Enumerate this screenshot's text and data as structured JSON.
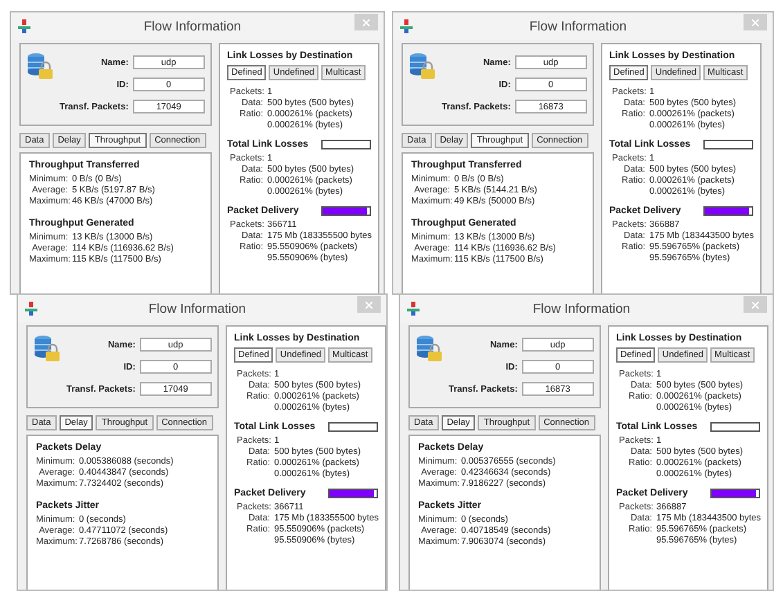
{
  "windows": [
    {
      "title": "Flow Information",
      "info": [
        {
          "label": "Name:",
          "value": "udp"
        },
        {
          "label": "ID:",
          "value": "0"
        },
        {
          "label": "Transf. Packets:",
          "value": "17049"
        }
      ],
      "tabs": [
        {
          "label": "Data",
          "selected": false
        },
        {
          "label": "Delay",
          "selected": false
        },
        {
          "label": "Throughput",
          "selected": true
        },
        {
          "label": "Connection",
          "selected": false
        }
      ],
      "sections": [
        {
          "title": "Throughput Transferred",
          "rows": [
            {
              "label": "Minimum:",
              "value": "0 B/s (0 B/s)"
            },
            {
              "label": "Average:",
              "value": "5 KB/s (5197.87 B/s)"
            },
            {
              "label": "Maximum:",
              "value": "46 KB/s (47000 B/s)"
            }
          ]
        },
        {
          "title": "Throughput Generated",
          "rows": [
            {
              "label": "Minimum:",
              "value": "13 KB/s (13000 B/s)"
            },
            {
              "label": "Average:",
              "value": "114 KB/s (116936.62 B/s)"
            },
            {
              "label": "Maximum:",
              "value": "115 KB/s (117500 B/s)"
            }
          ]
        }
      ],
      "link_losses": {
        "title": "Link Losses by Destination",
        "buttons": [
          {
            "label": "Defined",
            "selected": true
          },
          {
            "label": "Undefined",
            "selected": false
          },
          {
            "label": "Multicast",
            "selected": false
          }
        ],
        "rows": [
          {
            "label": "Packets:",
            "value": "1"
          },
          {
            "label": "Data:",
            "value": "500 bytes (500 bytes)"
          },
          {
            "label": "Ratio:",
            "value": "0.000261% (packets)"
          },
          {
            "value": "0.000261% (bytes)"
          }
        ]
      },
      "total_link_losses": {
        "title": "Total Link Losses",
        "rows": [
          {
            "label": "Packets:",
            "value": "1"
          },
          {
            "label": "Data:",
            "value": "500 bytes (500 bytes)"
          },
          {
            "label": "Ratio:",
            "value": "0.000261% (packets)"
          },
          {
            "value": "0.000261% (bytes)"
          }
        ]
      },
      "packet_delivery": {
        "title": "Packet Delivery",
        "level": 0.96,
        "rows": [
          {
            "label": "Packets:",
            "value": "366711"
          },
          {
            "label": "Data:",
            "value": "175 Mb (183355500 bytes"
          },
          {
            "label": "Ratio:",
            "value": "95.550906% (packets)"
          },
          {
            "value": "95.550906% (bytes)"
          }
        ]
      }
    },
    {
      "title": "Flow Information",
      "info": [
        {
          "label": "Name:",
          "value": "udp"
        },
        {
          "label": "ID:",
          "value": "0"
        },
        {
          "label": "Transf. Packets:",
          "value": "16873"
        }
      ],
      "tabs": [
        {
          "label": "Data",
          "selected": false
        },
        {
          "label": "Delay",
          "selected": false
        },
        {
          "label": "Throughput",
          "selected": true
        },
        {
          "label": "Connection",
          "selected": false
        }
      ],
      "sections": [
        {
          "title": "Throughput Transferred",
          "rows": [
            {
              "label": "Minimum:",
              "value": "0 B/s (0 B/s)"
            },
            {
              "label": "Average:",
              "value": "5 KB/s (5144.21 B/s)"
            },
            {
              "label": "Maximum:",
              "value": "49 KB/s (50000 B/s)"
            }
          ]
        },
        {
          "title": "Throughput Generated",
          "rows": [
            {
              "label": "Minimum:",
              "value": "13 KB/s (13000 B/s)"
            },
            {
              "label": "Average:",
              "value": "114 KB/s (116936.62 B/s)"
            },
            {
              "label": "Maximum:",
              "value": "115 KB/s (117500 B/s)"
            }
          ]
        }
      ],
      "link_losses": {
        "title": "Link Losses by Destination",
        "buttons": [
          {
            "label": "Defined",
            "selected": true
          },
          {
            "label": "Undefined",
            "selected": false
          },
          {
            "label": "Multicast",
            "selected": false
          }
        ],
        "rows": [
          {
            "label": "Packets:",
            "value": "1"
          },
          {
            "label": "Data:",
            "value": "500 bytes (500 bytes)"
          },
          {
            "label": "Ratio:",
            "value": "0.000261% (packets)"
          },
          {
            "value": "0.000261% (bytes)"
          }
        ]
      },
      "total_link_losses": {
        "title": "Total Link Losses",
        "rows": [
          {
            "label": "Packets:",
            "value": "1"
          },
          {
            "label": "Data:",
            "value": "500 bytes (500 bytes)"
          },
          {
            "label": "Ratio:",
            "value": "0.000261% (packets)"
          },
          {
            "value": "0.000261% (bytes)"
          }
        ]
      },
      "packet_delivery": {
        "title": "Packet Delivery",
        "level": 0.96,
        "rows": [
          {
            "label": "Packets:",
            "value": "366887"
          },
          {
            "label": "Data:",
            "value": "175 Mb (183443500 bytes"
          },
          {
            "label": "Ratio:",
            "value": "95.596765% (packets)"
          },
          {
            "value": "95.596765% (bytes)"
          }
        ]
      }
    },
    {
      "title": "Flow Information",
      "info": [
        {
          "label": "Name:",
          "value": "udp"
        },
        {
          "label": "ID:",
          "value": "0"
        },
        {
          "label": "Transf. Packets:",
          "value": "17049"
        }
      ],
      "tabs": [
        {
          "label": "Data",
          "selected": false
        },
        {
          "label": "Delay",
          "selected": true
        },
        {
          "label": "Throughput",
          "selected": false
        },
        {
          "label": "Connection",
          "selected": false
        }
      ],
      "sections": [
        {
          "title": "Packets Delay",
          "rows": [
            {
              "label": "Minimum:",
              "value": "0.005386088 (seconds)"
            },
            {
              "label": "Average:",
              "value": "0.40443847 (seconds)"
            },
            {
              "label": "Maximum:",
              "value": "7.7324402 (seconds)"
            }
          ]
        },
        {
          "title": "Packets Jitter",
          "rows": [
            {
              "label": "Minimum:",
              "value": "0 (seconds)"
            },
            {
              "label": "Average:",
              "value": "0.47711072 (seconds)"
            },
            {
              "label": "Maximum:",
              "value": "7.7268786 (seconds)"
            }
          ]
        }
      ],
      "link_losses": {
        "title": "Link Losses by Destination",
        "buttons": [
          {
            "label": "Defined",
            "selected": true
          },
          {
            "label": "Undefined",
            "selected": false
          },
          {
            "label": "Multicast",
            "selected": false
          }
        ],
        "rows": [
          {
            "label": "Packets:",
            "value": "1"
          },
          {
            "label": "Data:",
            "value": "500 bytes (500 bytes)"
          },
          {
            "label": "Ratio:",
            "value": "0.000261% (packets)"
          },
          {
            "value": "0.000261% (bytes)"
          }
        ]
      },
      "total_link_losses": {
        "title": "Total Link Losses",
        "rows": [
          {
            "label": "Packets:",
            "value": "1"
          },
          {
            "label": "Data:",
            "value": "500 bytes (500 bytes)"
          },
          {
            "label": "Ratio:",
            "value": "0.000261% (packets)"
          },
          {
            "value": "0.000261% (bytes)"
          }
        ]
      },
      "packet_delivery": {
        "title": "Packet Delivery",
        "level": 0.96,
        "rows": [
          {
            "label": "Packets:",
            "value": "366711"
          },
          {
            "label": "Data:",
            "value": "175 Mb (183355500 bytes"
          },
          {
            "label": "Ratio:",
            "value": "95.550906% (packets)"
          },
          {
            "value": "95.550906% (bytes)"
          }
        ]
      }
    },
    {
      "title": "Flow Information",
      "info": [
        {
          "label": "Name:",
          "value": "udp"
        },
        {
          "label": "ID:",
          "value": "0"
        },
        {
          "label": "Transf. Packets:",
          "value": "16873"
        }
      ],
      "tabs": [
        {
          "label": "Data",
          "selected": false
        },
        {
          "label": "Delay",
          "selected": true
        },
        {
          "label": "Throughput",
          "selected": false
        },
        {
          "label": "Connection",
          "selected": false
        }
      ],
      "sections": [
        {
          "title": "Packets Delay",
          "rows": [
            {
              "label": "Minimum:",
              "value": "0.005376555 (seconds)"
            },
            {
              "label": "Average:",
              "value": "0.42346634 (seconds)"
            },
            {
              "label": "Maximum:",
              "value": "7.9186227 (seconds)"
            }
          ]
        },
        {
          "title": "Packets Jitter",
          "rows": [
            {
              "label": "Minimum:",
              "value": "0 (seconds)"
            },
            {
              "label": "Average:",
              "value": "0.40718549 (seconds)"
            },
            {
              "label": "Maximum:",
              "value": "7.9063074 (seconds)"
            }
          ]
        }
      ],
      "link_losses": {
        "title": "Link Losses by Destination",
        "buttons": [
          {
            "label": "Defined",
            "selected": true
          },
          {
            "label": "Undefined",
            "selected": false
          },
          {
            "label": "Multicast",
            "selected": false
          }
        ],
        "rows": [
          {
            "label": "Packets:",
            "value": "1"
          },
          {
            "label": "Data:",
            "value": "500 bytes (500 bytes)"
          },
          {
            "label": "Ratio:",
            "value": "0.000261% (packets)"
          },
          {
            "value": "0.000261% (bytes)"
          }
        ]
      },
      "total_link_losses": {
        "title": "Total Link Losses",
        "rows": [
          {
            "label": "Packets:",
            "value": "1"
          },
          {
            "label": "Data:",
            "value": "500 bytes (500 bytes)"
          },
          {
            "label": "Ratio:",
            "value": "0.000261% (packets)"
          },
          {
            "value": "0.000261% (bytes)"
          }
        ]
      },
      "packet_delivery": {
        "title": "Packet Delivery",
        "level": 0.96,
        "rows": [
          {
            "label": "Packets:",
            "value": "366887"
          },
          {
            "label": "Data:",
            "value": "175 Mb (183443500 bytes"
          },
          {
            "label": "Ratio:",
            "value": "95.596765% (packets)"
          },
          {
            "value": "95.596765% (bytes)"
          }
        ]
      }
    }
  ]
}
